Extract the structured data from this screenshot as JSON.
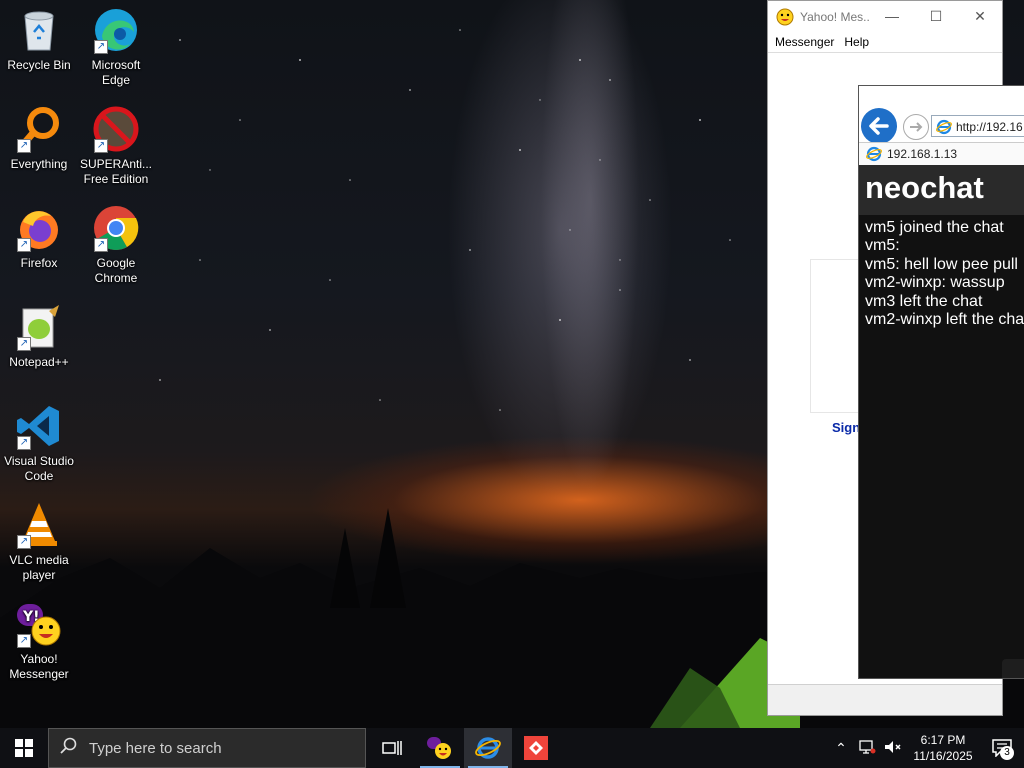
{
  "desktop": {
    "icons": [
      {
        "label": "Recycle Bin",
        "icon": "recycle-bin-icon"
      },
      {
        "label": "Microsoft Edge",
        "icon": "edge-icon"
      },
      {
        "label": "Everything",
        "icon": "everything-icon"
      },
      {
        "label": "SUPERAnti... Free Edition",
        "icon": "superantispyware-icon"
      },
      {
        "label": "Firefox",
        "icon": "firefox-icon"
      },
      {
        "label": "Google Chrome",
        "icon": "chrome-icon"
      },
      {
        "label": "Notepad++",
        "icon": "notepadpp-icon"
      },
      {
        "label": "Visual Studio Code",
        "icon": "vscode-icon"
      },
      {
        "label": "VLC media player",
        "icon": "vlc-icon"
      },
      {
        "label": "Yahoo! Messenger",
        "icon": "yahoo-messenger-icon"
      }
    ]
  },
  "yahoo_window": {
    "title": "Yahoo! Mes...",
    "menu": [
      "Messenger",
      "Help"
    ],
    "signin_text": "Sign"
  },
  "ie_window": {
    "address": "http://192.16",
    "tab_title": "192.168.1.13",
    "page_title": "neochat",
    "messages": [
      "vm5 joined the chat",
      "vm5:",
      "vm5: hell low pee pull",
      "vm2-winxp: wassup",
      "vm3 left the chat",
      "vm2-winxp left the cha"
    ]
  },
  "taskbar": {
    "search_placeholder": "Type here to search",
    "time": "6:17 PM",
    "date": "11/16/2025",
    "notification_count": "3",
    "colors": {
      "accent": "#7fb4ea",
      "background": "#0f1014"
    }
  }
}
